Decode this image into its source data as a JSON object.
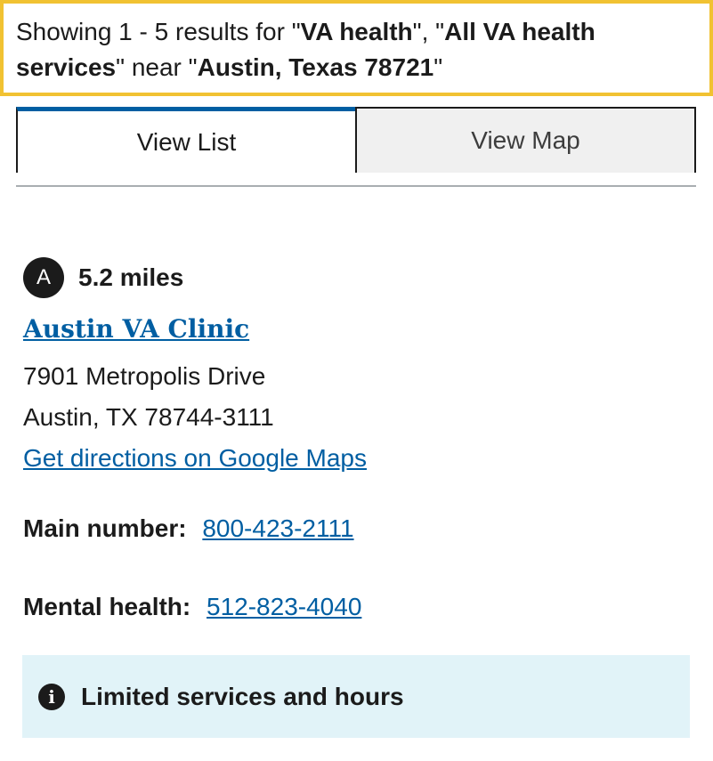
{
  "results_banner": {
    "prefix": "Showing 1 - 5 results for \"",
    "query": "VA health",
    "mid": "\", \"",
    "service": "All VA health services",
    "near": "\" near \"",
    "location": "Austin, Texas 78721",
    "suffix": "\""
  },
  "tabs": {
    "list_label": "View List",
    "map_label": "View Map",
    "active": "View List"
  },
  "result": {
    "marker": "A",
    "distance": "5.2 miles",
    "name": "Austin VA Clinic",
    "address_line1": "7901 Metropolis Drive",
    "address_line2": "Austin, TX 78744-3111",
    "directions_label": "Get directions on Google Maps",
    "main_number_label": "Main number:",
    "main_number": "800-423-2111",
    "mental_health_label": "Mental health:",
    "mental_health_number": "512-823-4040"
  },
  "alert": {
    "icon": "info-icon",
    "text": "Limited services and hours"
  },
  "colors": {
    "link": "#005ea2",
    "banner_border": "#f1c232",
    "alert_bg": "#e1f3f8"
  }
}
